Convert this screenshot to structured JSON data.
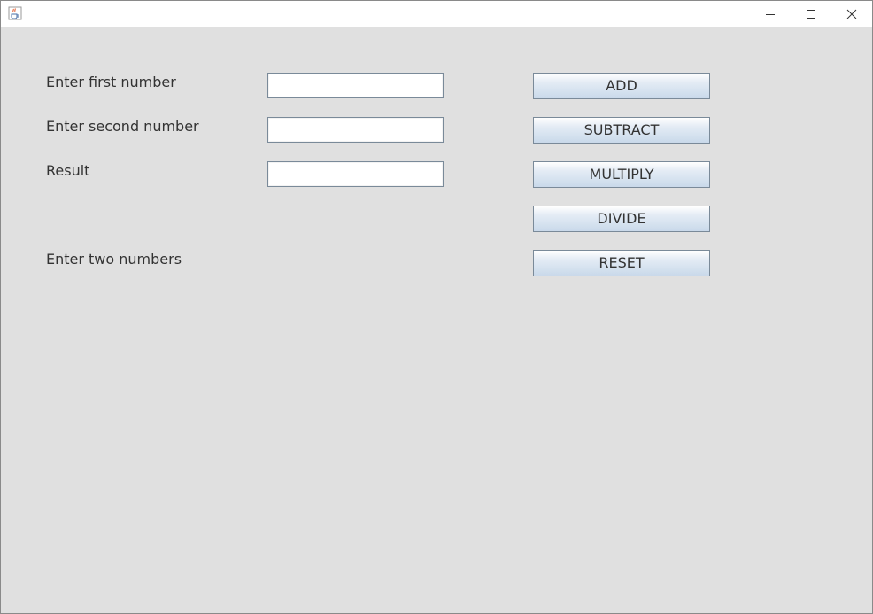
{
  "window": {
    "title": "",
    "app_icon": "java-cup-icon",
    "controls": {
      "minimize_icon": "minimize-icon",
      "maximize_icon": "maximize-icon",
      "close_icon": "close-icon"
    }
  },
  "form": {
    "first_label": "Enter first number",
    "first_value": "",
    "second_label": "Enter second number",
    "second_value": "",
    "result_label": "Result",
    "result_value": "",
    "status_text": "Enter two numbers"
  },
  "buttons": {
    "add": "ADD",
    "subtract": "SUBTRACT",
    "multiply": "MULTIPLY",
    "divide": "DIVIDE",
    "reset": "RESET"
  },
  "colors": {
    "background": "#e0e0e0",
    "titlebar": "#ffffff",
    "button_gradient_top": "#ffffff",
    "button_gradient_bottom": "#c9d9ea",
    "border": "#7a8a99",
    "text": "#333333"
  }
}
